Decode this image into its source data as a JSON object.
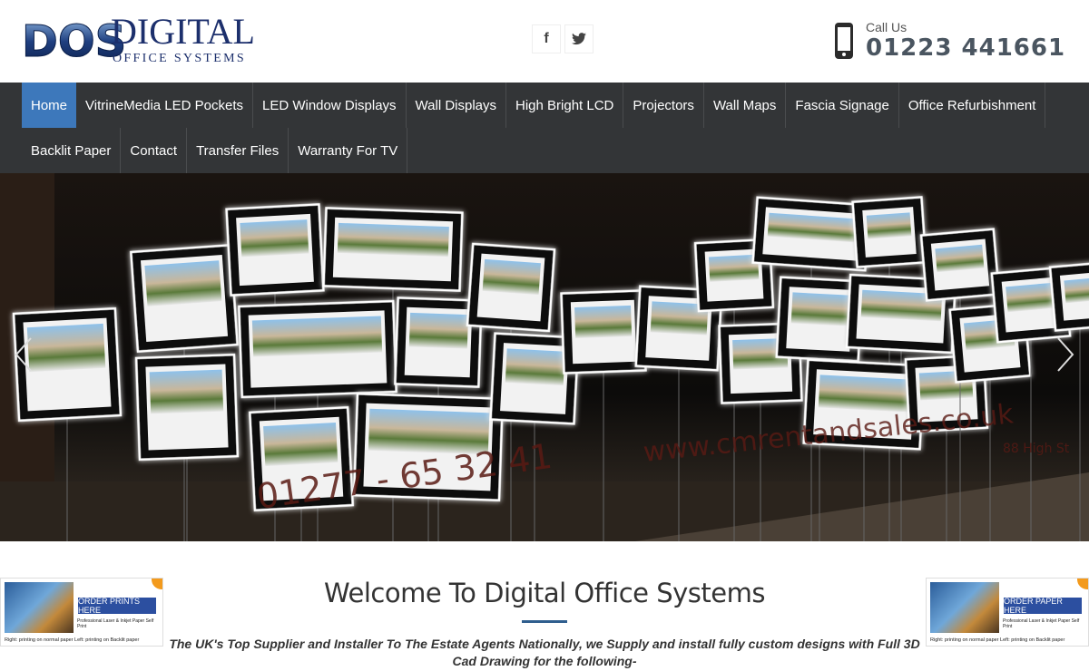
{
  "header": {
    "logo_mark": "DOS",
    "logo_title": "DIGITAL",
    "logo_subtitle": "OFFICE SYSTEMS",
    "social": {
      "facebook_glyph": "f",
      "twitter_glyph": "t"
    },
    "call_label": "Call Us",
    "call_number": "01223 441661"
  },
  "nav": {
    "row1": [
      "Home",
      "VitrineMedia LED Pockets",
      "LED Window Displays",
      "Wall Displays",
      "High Bright LCD",
      "Projectors",
      "Wall Maps",
      "Fascia Signage",
      "Office Refurbishment"
    ],
    "row2": [
      "Backlit Paper",
      "Contact",
      "Transfer Files",
      "Warranty For TV"
    ],
    "active": "Home"
  },
  "hero": {
    "window_phone": "01277 - 65 32 41",
    "window_url": "www.cmrentandsales.co.uk",
    "window_address": "88 High St"
  },
  "welcome": {
    "title": "Welcome To Digital Office Systems",
    "description": "The UK's Top Supplier and Installer To The Estate Agents Nationally, we Supply and install fully custom designs with Full 3D Cad Drawing for the following-"
  },
  "promo_left": {
    "button": "ORDER PRINTS HERE",
    "sub": "Professional Laser & Inkjet Paper Self Print",
    "foot": "Right: printing on normal paper   Left: printing on Backlit paper"
  },
  "promo_right": {
    "button": "ORDER PAPER HERE",
    "sub": "Professional Laser & Inkjet Paper Self Print",
    "foot": "Right: printing on normal paper   Left: printing on Backlit paper"
  },
  "colors": {
    "nav_bg": "#333537",
    "nav_active": "#3d78bb",
    "accent": "#2f5e8e"
  }
}
